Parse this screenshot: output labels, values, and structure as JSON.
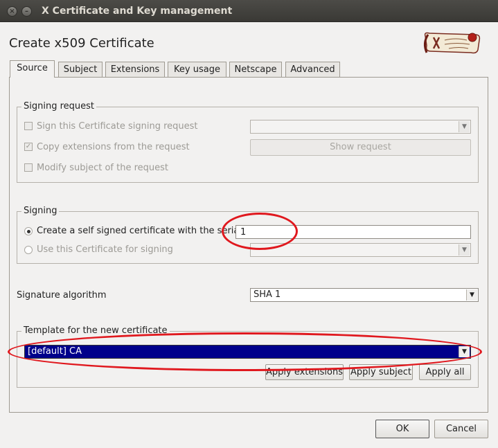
{
  "window": {
    "title": "X Certificate and Key management",
    "close_glyph": "×",
    "minimize_glyph": "–"
  },
  "heading": "Create x509 Certificate",
  "tabs": [
    {
      "label": "Source"
    },
    {
      "label": "Subject"
    },
    {
      "label": "Extensions"
    },
    {
      "label": "Key usage"
    },
    {
      "label": "Netscape"
    },
    {
      "label": "Advanced"
    }
  ],
  "signing_request": {
    "legend": "Signing request",
    "sign_csr_label": "Sign this Certificate signing request",
    "copy_ext_label": "Copy extensions from the request",
    "modify_subject_label": "Modify subject of the request",
    "show_request_button": "Show request",
    "check_glyph": "✓"
  },
  "signing": {
    "legend": "Signing",
    "self_signed_label": "Create a self signed certificate with the seria",
    "serial_value": "1",
    "use_cert_label": "Use this Certificate for signing"
  },
  "signature_algorithm": {
    "label": "Signature algorithm",
    "value": "SHA 1"
  },
  "template": {
    "legend": "Template for the new certificate",
    "selected": "[default] CA",
    "apply_extensions": "Apply extensions",
    "apply_subject": "Apply subject",
    "apply_all": "Apply all"
  },
  "footer": {
    "ok": "OK",
    "cancel": "Cancel"
  },
  "icons": {
    "dropdown_arrow": "▼"
  },
  "colors": {
    "selection_bg": "#00008b",
    "annotation_red": "#e0181e",
    "titlebar": "#3f3e3a"
  }
}
